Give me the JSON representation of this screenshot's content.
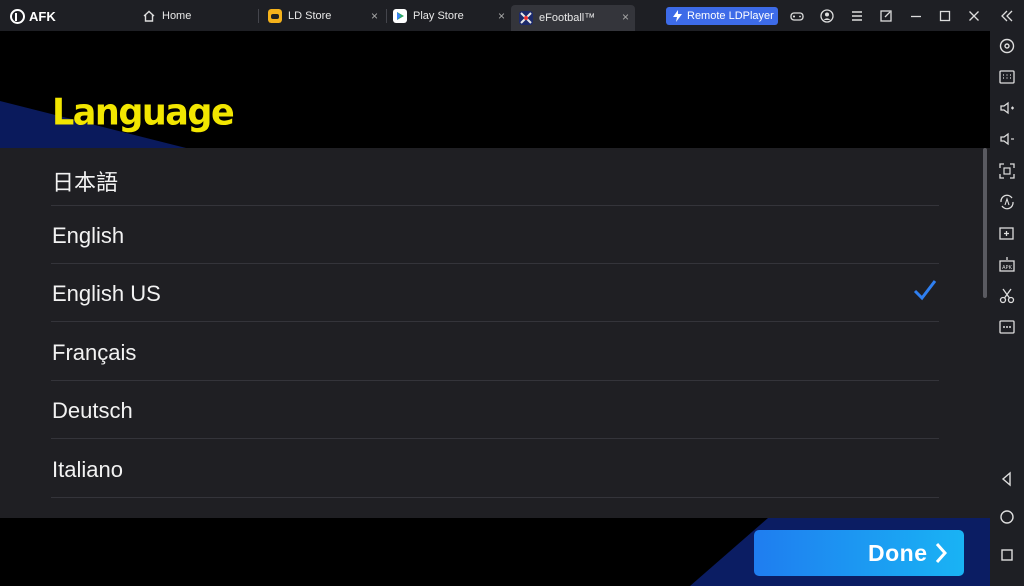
{
  "titlebar": {
    "logo_text": "AFK",
    "tabs": [
      {
        "label": "Home",
        "icon": "home-icon"
      },
      {
        "label": "LD Store",
        "icon": "gamepad-icon",
        "close": "×"
      },
      {
        "label": "Play Store",
        "icon": "play-store-icon",
        "close": "×"
      },
      {
        "label": "eFootball™",
        "icon": "efootball-icon",
        "close": "×"
      }
    ],
    "remote_label": "Remote LDPlayer",
    "controls": [
      "controller-icon",
      "account-icon",
      "menu-icon",
      "popout-icon",
      "minimize-icon",
      "maximize-icon",
      "close-icon",
      "collapse-icon"
    ]
  },
  "game": {
    "heading": "Language",
    "languages": [
      {
        "label": "日本語",
        "selected": false
      },
      {
        "label": "English",
        "selected": false
      },
      {
        "label": "English US",
        "selected": true
      },
      {
        "label": "Français",
        "selected": false
      },
      {
        "label": "Deutsch",
        "selected": false
      },
      {
        "label": "Italiano",
        "selected": false
      }
    ],
    "done_label": "Done",
    "colors": {
      "heading": "#f2e600",
      "check": "#2f7ff0",
      "done_start": "#1f7df0",
      "done_end": "#19b3f4"
    }
  },
  "sidebar": {
    "icons": [
      "settings-icon",
      "keyboard-icon",
      "volume-up-icon",
      "volume-down-icon",
      "fullscreen-icon",
      "sync-icon",
      "add-window-icon",
      "apk-icon",
      "scissors-icon",
      "more-icon",
      "back-icon",
      "home-circle-icon",
      "recents-icon"
    ]
  }
}
